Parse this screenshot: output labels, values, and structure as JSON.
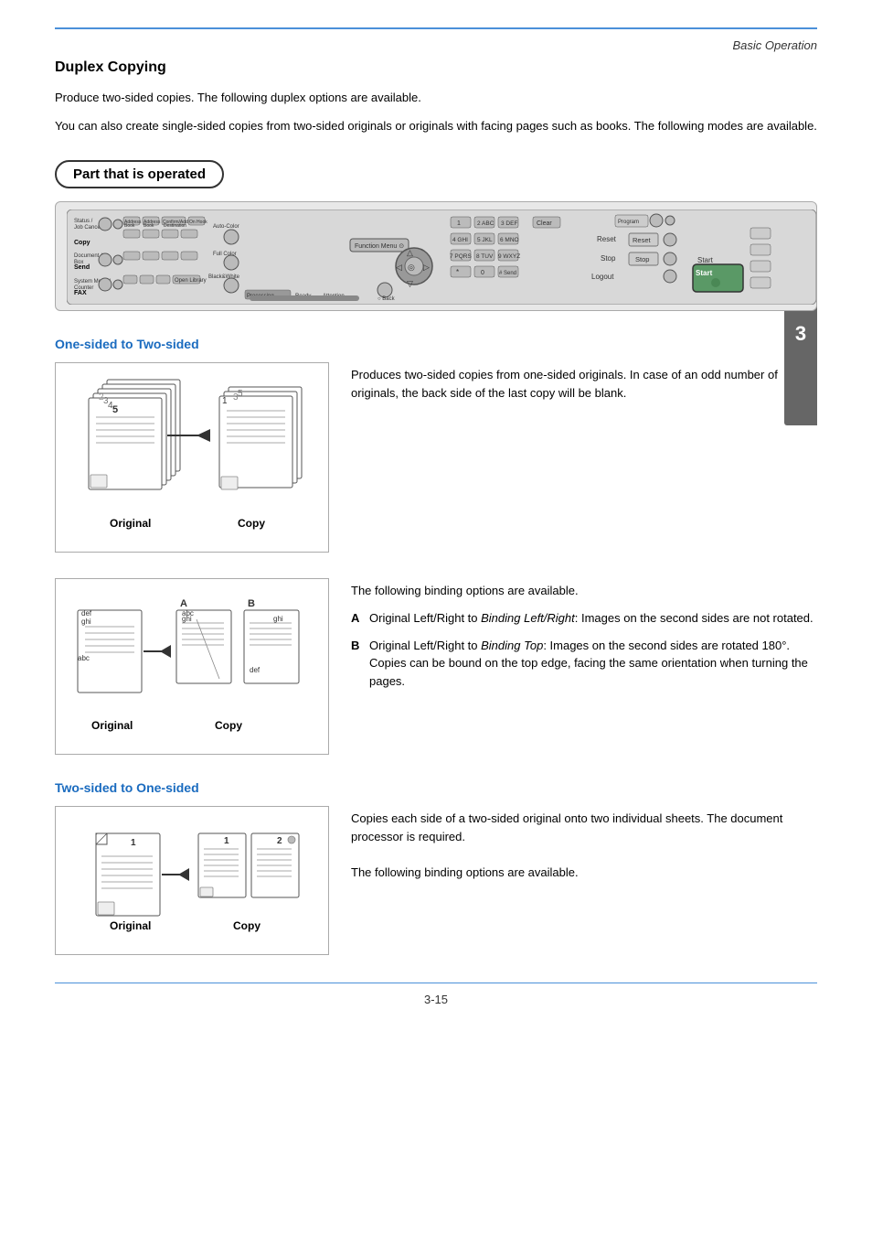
{
  "header": {
    "title": "Basic Operation",
    "chapter_number": "3"
  },
  "section": {
    "title": "Duplex Copying",
    "intro1": "Produce two-sided copies. The following duplex options are available.",
    "intro2": "You can also create single-sided copies from two-sided originals or originals with facing pages such as books. The following modes are available."
  },
  "part_operated_badge": "Part that is operated",
  "subsections": [
    {
      "title": "One-sided to Two-sided",
      "description": "Produces two-sided copies from one-sided originals. In case of an odd number of originals, the back side of the last copy will be blank.",
      "description2": "The following binding options are available.",
      "original_label": "Original",
      "copy_label": "Copy",
      "binding_options": [
        {
          "letter": "A",
          "text_before": "Original Left/Right to ",
          "text_italic": "Binding Left/Right",
          "text_after": ": Images on the second sides are not rotated."
        },
        {
          "letter": "B",
          "text_before": "Original Left/Right to ",
          "text_italic": "Binding Top",
          "text_after": ": Images on the second sides are rotated 180°.  Copies can be bound on the top edge, facing the same orientation when turning the pages."
        }
      ]
    },
    {
      "title": "Two-sided to One-sided",
      "description": "Copies each side of a two-sided original onto two individual sheets. The document processor is required.",
      "description2": "The following binding options are available.",
      "original_label": "Original",
      "copy_label": "Copy"
    }
  ],
  "page_number": "3-15",
  "panel": {
    "copy_label": "Copy",
    "send_label": "Send",
    "fax_label": "FAX",
    "function_menu": "Function Menu",
    "auto_color": "Auto-Color",
    "full_color": "Full Color",
    "black_white": "Black&White",
    "back": "Back",
    "processing": "Processing",
    "ready": "Ready",
    "attention": "Attention",
    "clear": "Clear",
    "reset": "Reset",
    "stop": "Stop",
    "start": "Start",
    "logout": "Logout",
    "num_buttons": [
      "1",
      "2ABC",
      "3DEF",
      "4GHI",
      "5JKL",
      "6MNO",
      "7PQRS",
      "8TUV",
      "9WXYZ",
      "*",
      "0",
      "#Send"
    ]
  }
}
